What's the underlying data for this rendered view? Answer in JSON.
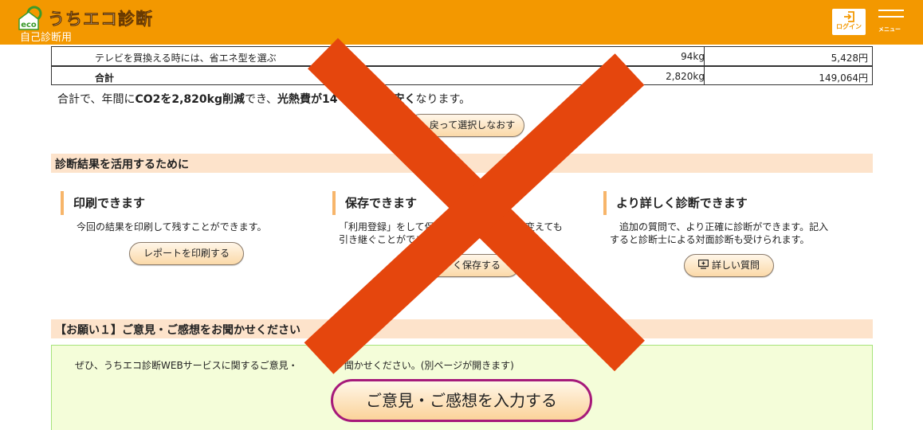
{
  "header": {
    "logo_badge": "eco",
    "title": "うちエコ診断",
    "subtitle": "自己診断用",
    "login_label": "ログイン",
    "menu_label": "メニュー",
    "colors": {
      "brand": "#f39800"
    }
  },
  "table": {
    "rows": [
      {
        "name": "テレビを買換える時には、省エネ型を選ぶ",
        "co2": "94kg",
        "cost": "5,428円"
      }
    ],
    "total": {
      "name": "合計",
      "co2": "2,820kg",
      "cost": "149,064円"
    }
  },
  "summary": {
    "pre": "合計で、年間に",
    "co2_bold": "CO2を2,820kg削減",
    "mid": "でき、",
    "cost_bold_a": "光熱費が14",
    "cost_bold_b": "安く",
    "post": "なります。"
  },
  "reselect_button": "戻って選択しなおす",
  "use_section": {
    "heading": "診断結果を活用するために",
    "columns": [
      {
        "title": "印刷できます",
        "text": [
          "今回の結果を印刷して残すことができます。"
        ],
        "button": "レポートを印刷する"
      },
      {
        "title": "保存できます",
        "text": [
          "「利用登録」をして保存",
          "引き継ぐことができま"
        ],
        "text_tail": "を変えても",
        "button_a": "利",
        "button_b": "く保存する"
      },
      {
        "title": "より詳しく診断できます",
        "text": [
          "追加の質問で、より正確に診断ができます。記入",
          "すると診断士による対面診断も受けられます。"
        ],
        "button": "詳しい質問"
      }
    ]
  },
  "feedback": {
    "heading": "【お願い１】ご意見・ご感想をお聞かせください",
    "text_a": "ぜひ、うちエコ診断WEBサービスに関するご意見・",
    "text_b": "聞かせください。(別ページが開きます)",
    "button": "ご意見・ご感想を入力する"
  },
  "overlay": {
    "icon": "cross-mark-icon",
    "color": "#e5460d"
  }
}
